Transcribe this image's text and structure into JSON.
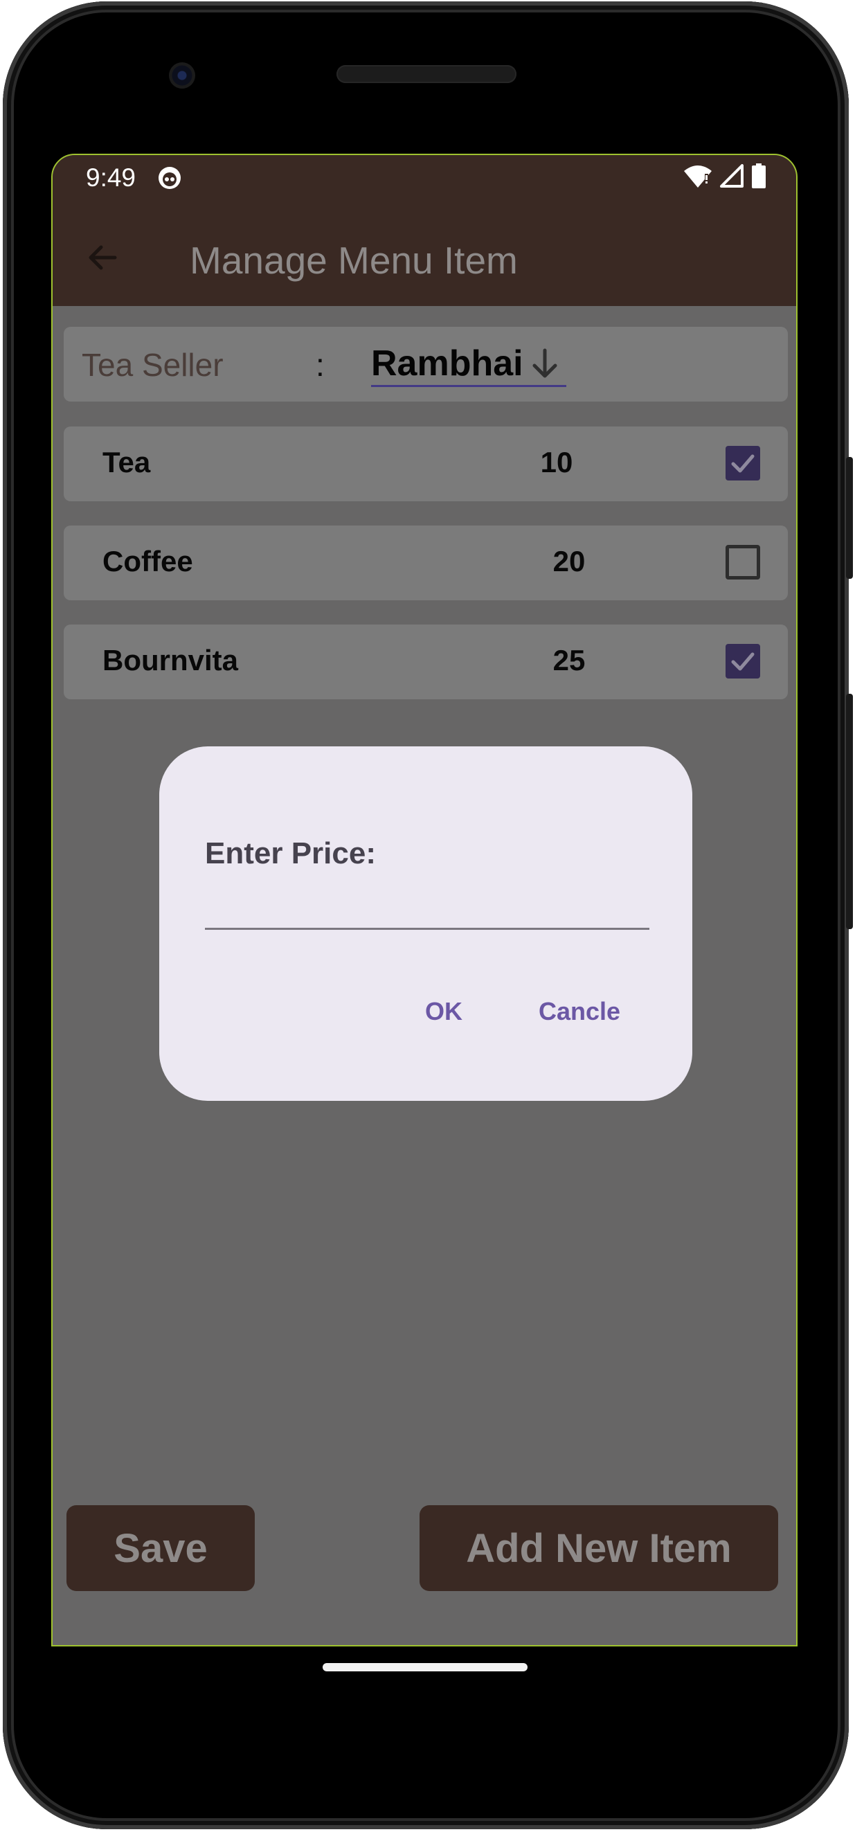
{
  "status_bar": {
    "time": "9:49"
  },
  "app_bar": {
    "title": "Manage Menu Item"
  },
  "seller": {
    "label": "Tea Seller",
    "separator": ":",
    "selected": "Rambhai"
  },
  "menu_items": [
    {
      "name": "Tea",
      "price": "10",
      "checked": true
    },
    {
      "name": "Coffee",
      "price": "20",
      "checked": false
    },
    {
      "name": "Bournvita",
      "price": "25",
      "checked": true
    }
  ],
  "buttons": {
    "save": "Save",
    "add_new": "Add New Item"
  },
  "dialog": {
    "title": "Enter Price:",
    "input_value": "",
    "ok": "OK",
    "cancel": "Cancle"
  },
  "colors": {
    "app_bar": "#3a2923",
    "overlay": "#676666",
    "checkbox_checked": "#352c55",
    "dialog_bg": "#ece8f2",
    "dialog_action": "#6b57a5"
  }
}
